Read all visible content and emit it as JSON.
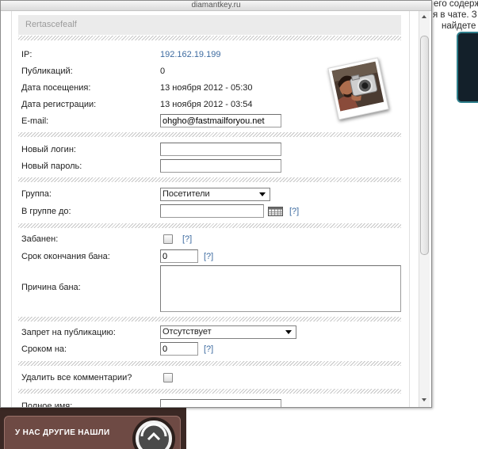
{
  "window": {
    "title": "diamantkey.ru"
  },
  "header": {
    "username": "Rertascefealf"
  },
  "info": {
    "ip_label": "IP:",
    "ip_value": "192.162.19.199",
    "posts_label": "Публикаций:",
    "posts_value": "0",
    "visit_label": "Дата посещения:",
    "visit_value": "13 ноября 2012 - 05:30",
    "reg_label": "Дата регистрации:",
    "reg_value": "13 ноября 2012 - 03:54",
    "email_label": "E-mail:",
    "email_value": "ohgho@fastmailforyou.net"
  },
  "account": {
    "login_label": "Новый логин:",
    "login_value": "",
    "password_label": "Новый пароль:",
    "password_value": ""
  },
  "group": {
    "group_label": "Группа:",
    "group_selected": "Посетители",
    "until_label": "В группе до:",
    "until_value": "",
    "help": "[?]"
  },
  "ban": {
    "banned_label": "Забанен:",
    "banned_checked": false,
    "banned_help": "[?]",
    "end_label": "Срок окончания бана:",
    "end_value": "0",
    "end_help": "[?]",
    "reason_label": "Причина бана:",
    "reason_value": ""
  },
  "restriction": {
    "label": "Запрет на публикацию:",
    "selected": "Отсутствует",
    "term_label": "Сроком на:",
    "term_value": "0",
    "term_help": "[?]"
  },
  "comments": {
    "delete_label": "Удалить все комментарии?",
    "delete_checked": false
  },
  "profile": {
    "fullname_label": "Полное имя:",
    "fullname_value": ""
  },
  "background": {
    "text_line1": "его содерж",
    "text_line2": "я в чате. З",
    "text_line3": "найдете",
    "banner_title": "У НАС ДРУГИЕ НАШЛИ"
  },
  "icons": {
    "avatar": "user-photo-icon",
    "calendar": "calendar-icon",
    "banner": "circle-arrow-icon"
  },
  "colors": {
    "link": "#3d6ba0",
    "header_bg": "#ebebeb",
    "banner_bg": "#6e4a44",
    "dark_box_border": "#2f7f8c"
  }
}
